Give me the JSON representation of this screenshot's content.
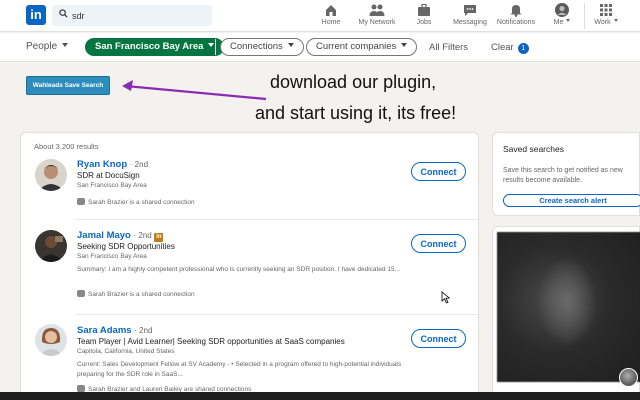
{
  "nav": {
    "logo": "in",
    "search_value": "sdr",
    "items": [
      {
        "label": "Home",
        "icon": "home-icon"
      },
      {
        "label": "My Network",
        "icon": "network-icon"
      },
      {
        "label": "Jobs",
        "icon": "briefcase-icon"
      },
      {
        "label": "Messaging",
        "icon": "message-icon"
      },
      {
        "label": "Notifications",
        "icon": "bell-icon"
      },
      {
        "label": "Me",
        "icon": "avatar"
      },
      {
        "label": "Work",
        "icon": "grid-icon"
      }
    ]
  },
  "filters": {
    "people": "People",
    "location": "San Francisco Bay Area",
    "connections": "Connections",
    "companies": "Current companies",
    "all_filters": "All Filters",
    "clear": "Clear",
    "clear_count": "1"
  },
  "promo": {
    "button": "Wahleads Save Search",
    "line1": "download our plugin,",
    "line2": "and start using it, its free!"
  },
  "results": {
    "count": "About 3,200 results",
    "connect_label": "Connect",
    "items": [
      {
        "name": "Ryan Knop",
        "degree": "· 2nd",
        "headline": "SDR at DocuSign",
        "location": "San Francisco Bay Area",
        "summary": "",
        "shared": "Sarah Brazier is a shared connection"
      },
      {
        "name": "Jamal Mayo",
        "degree": "· 2nd",
        "headline": "Seeking SDR Opportunities",
        "location": "San Francisco Bay Area",
        "summary": "Summary: I am a highly competent professional who is currently seeking an SDR position. I have dedicated 15...",
        "shared": "Sarah Brazier is a shared connection"
      },
      {
        "name": "Sara Adams",
        "degree": "· 2nd",
        "headline": "Team Player | Avid Learner| Seeking SDR opportunities at SaaS companies",
        "location": "Capitola, California, United States",
        "summary": "Current: Sales Development Fellow at SV Academy - • Selected in a program offered to high-potential individuals preparing for the SDR role in SaaS...",
        "shared": "Sarah Brazier and Lauren Bailey are shared connections"
      }
    ]
  },
  "saved_searches": {
    "title": "Saved searches",
    "description": "Save this search to get notified as new results become available.",
    "button": "Create search alert"
  },
  "colors": {
    "brand": "#0a66c2",
    "filter_green": "#057642",
    "plugin_button": "#2d8dbd",
    "arrow": "#8a2bb5"
  }
}
